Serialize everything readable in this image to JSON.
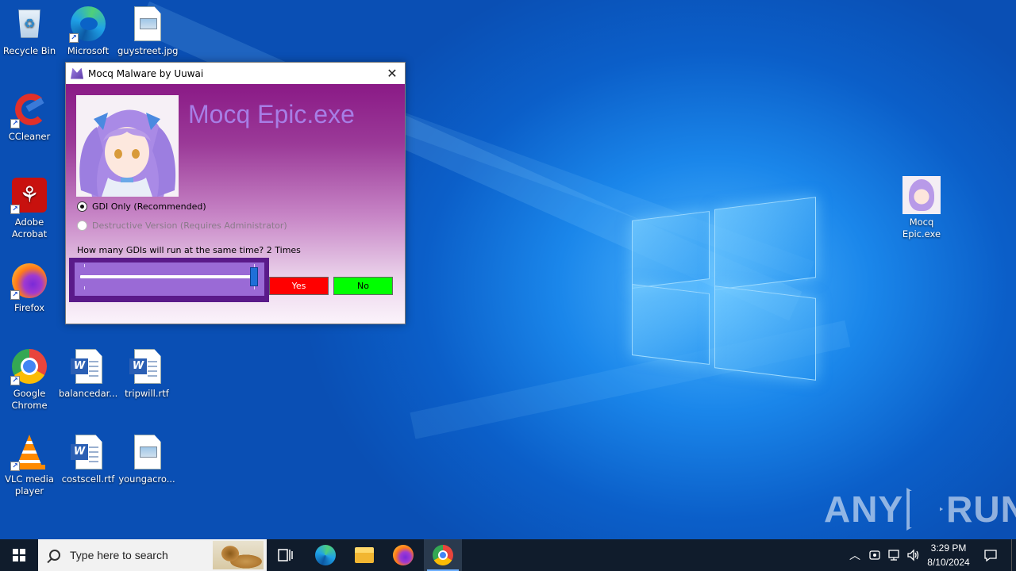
{
  "desktop": {
    "icons": [
      {
        "label": "Recycle Bin",
        "icon": "recycle-bin-icon"
      },
      {
        "label": "Microsoft Edge",
        "icon": "edge-icon"
      },
      {
        "label": "guystreet.jpg",
        "icon": "image-file-icon"
      },
      {
        "label": "CCleaner",
        "icon": "ccleaner-icon"
      },
      {
        "label": "Adobe Acrobat",
        "icon": "acrobat-icon"
      },
      {
        "label": "Firefox",
        "icon": "firefox-icon"
      },
      {
        "label": "Google Chrome",
        "icon": "chrome-icon"
      },
      {
        "label": "balancedar...",
        "icon": "word-doc-icon"
      },
      {
        "label": "tripwill.rtf",
        "icon": "word-doc-icon"
      },
      {
        "label": "VLC media player",
        "icon": "vlc-icon"
      },
      {
        "label": "costscell.rtf",
        "icon": "word-doc-icon"
      },
      {
        "label": "youngacro...",
        "icon": "image-file-icon"
      },
      {
        "label": "Mocq Epic.exe",
        "icon": "exe-avatar-icon"
      }
    ]
  },
  "dialog": {
    "title": "Mocq Malware by Uuwai",
    "close_glyph": "✕",
    "app_name": "Mocq Epic.exe",
    "options": [
      {
        "label": "GDI Only (Recommended)",
        "checked": true,
        "enabled": true
      },
      {
        "label": "Destructive Version (Requires Administrator)",
        "checked": false,
        "enabled": false
      }
    ],
    "question": "How many GDIs will run at the same time? 2 Times",
    "slider": {
      "value": 2,
      "min": 1,
      "max": 2
    },
    "yes_label": "Yes",
    "no_label": "No",
    "colors": {
      "yes": "#ff0000",
      "no": "#00ff00",
      "title": "#a77ee6"
    }
  },
  "watermark": {
    "left": "ANY",
    "right": "RUN"
  },
  "taskbar": {
    "search_placeholder": "Type here to search",
    "pinned": [
      "task-view-icon",
      "edge-icon",
      "file-explorer-icon",
      "firefox-icon",
      "chrome-icon"
    ],
    "active": "chrome-icon",
    "clock_time": "3:29 PM",
    "clock_date": "8/10/2024"
  }
}
